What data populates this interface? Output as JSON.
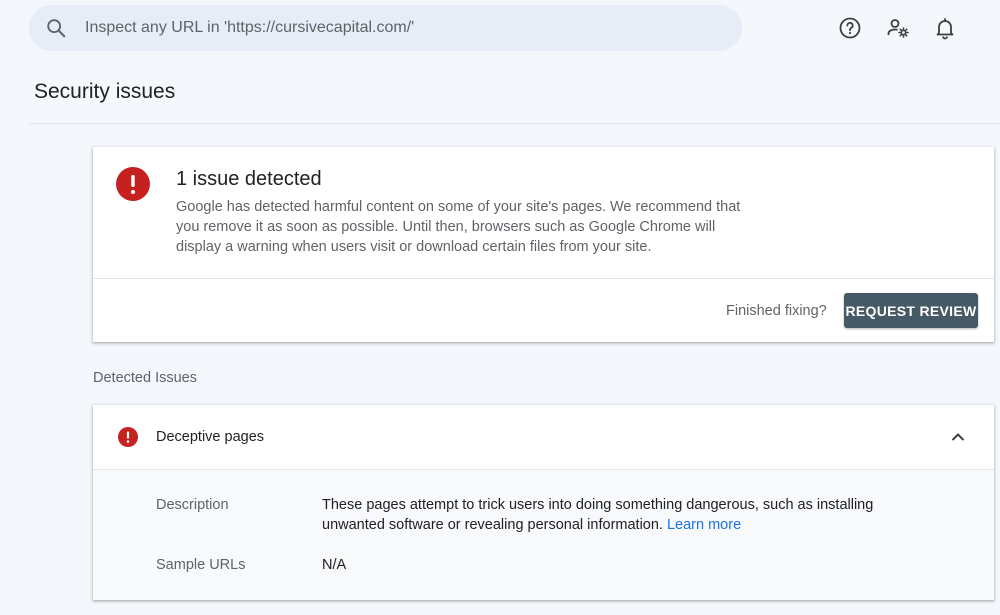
{
  "search": {
    "placeholder": "Inspect any URL in 'https://cursivecapital.com/'"
  },
  "header_icons": [
    "help-icon",
    "admin-settings-icon",
    "notifications-bell-icon"
  ],
  "page": {
    "title": "Security issues"
  },
  "summary": {
    "heading": "1 issue detected",
    "description": "Google has detected harmful content on some of your site's pages. We recommend that you remove it as soon as possible. Until then, browsers such as Google Chrome will display a warning when users visit or download certain files from your site.",
    "finished_prompt": "Finished fixing?",
    "review_button": "REQUEST REVIEW"
  },
  "detected": {
    "section_label": "Detected Issues",
    "issue_name": "Deceptive pages",
    "description_label": "Description",
    "description_text": "These pages attempt to trick users into doing something dangerous, such as installing unwanted software or revealing personal information.",
    "learn_more": "Learn more",
    "sample_urls_label": "Sample URLs",
    "sample_urls_value": "N/A"
  },
  "colors": {
    "error_red": "#c5221f",
    "button_bg": "#455a64",
    "link": "#1a73e8",
    "background": "#f4f8fc"
  }
}
